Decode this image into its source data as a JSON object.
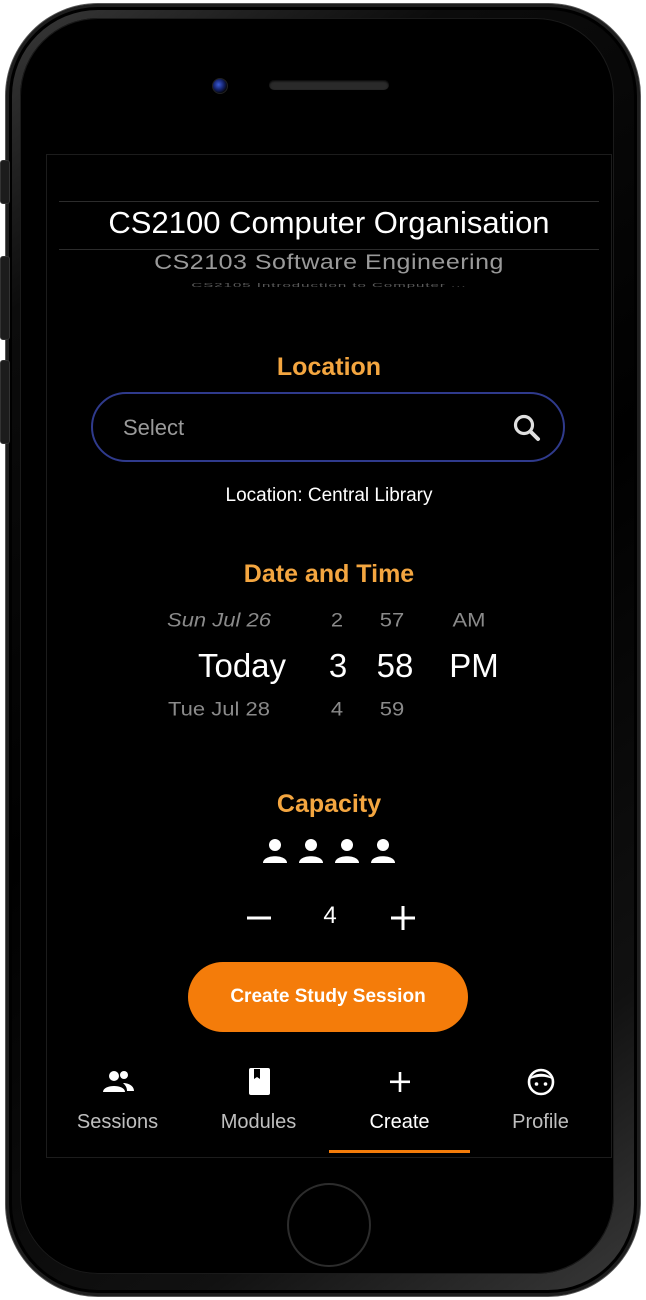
{
  "modules": {
    "selected": "CS2100 Computer Organisation",
    "next": "CS2103 Software Engineering",
    "next2": "CS2105 Introduction to Computer ..."
  },
  "location": {
    "title": "Location",
    "search_placeholder": "Select",
    "current": "Location: Central Library"
  },
  "datetime": {
    "title": "Date and Time",
    "prev": {
      "day": "Sun Jul 26",
      "hour": "2",
      "minute": "57",
      "ampm": "AM"
    },
    "selected": {
      "day": "Today",
      "hour": "3",
      "minute": "58",
      "ampm": "PM"
    },
    "next": {
      "day": "Tue Jul 28",
      "hour": "4",
      "minute": "59"
    }
  },
  "capacity": {
    "title": "Capacity",
    "value": "4",
    "icon": "person-icon"
  },
  "actions": {
    "create_label": "Create Study Session"
  },
  "tabs": [
    {
      "label": "Sessions",
      "icon": "people-icon",
      "active": false
    },
    {
      "label": "Modules",
      "icon": "book-icon",
      "active": false
    },
    {
      "label": "Create",
      "icon": "plus-icon",
      "active": true
    },
    {
      "label": "Profile",
      "icon": "face-icon",
      "active": false
    }
  ],
  "colors": {
    "accent": "#f47c0a",
    "section_title": "#f4a640",
    "search_border": "#2f3a8c",
    "background": "#000000"
  }
}
